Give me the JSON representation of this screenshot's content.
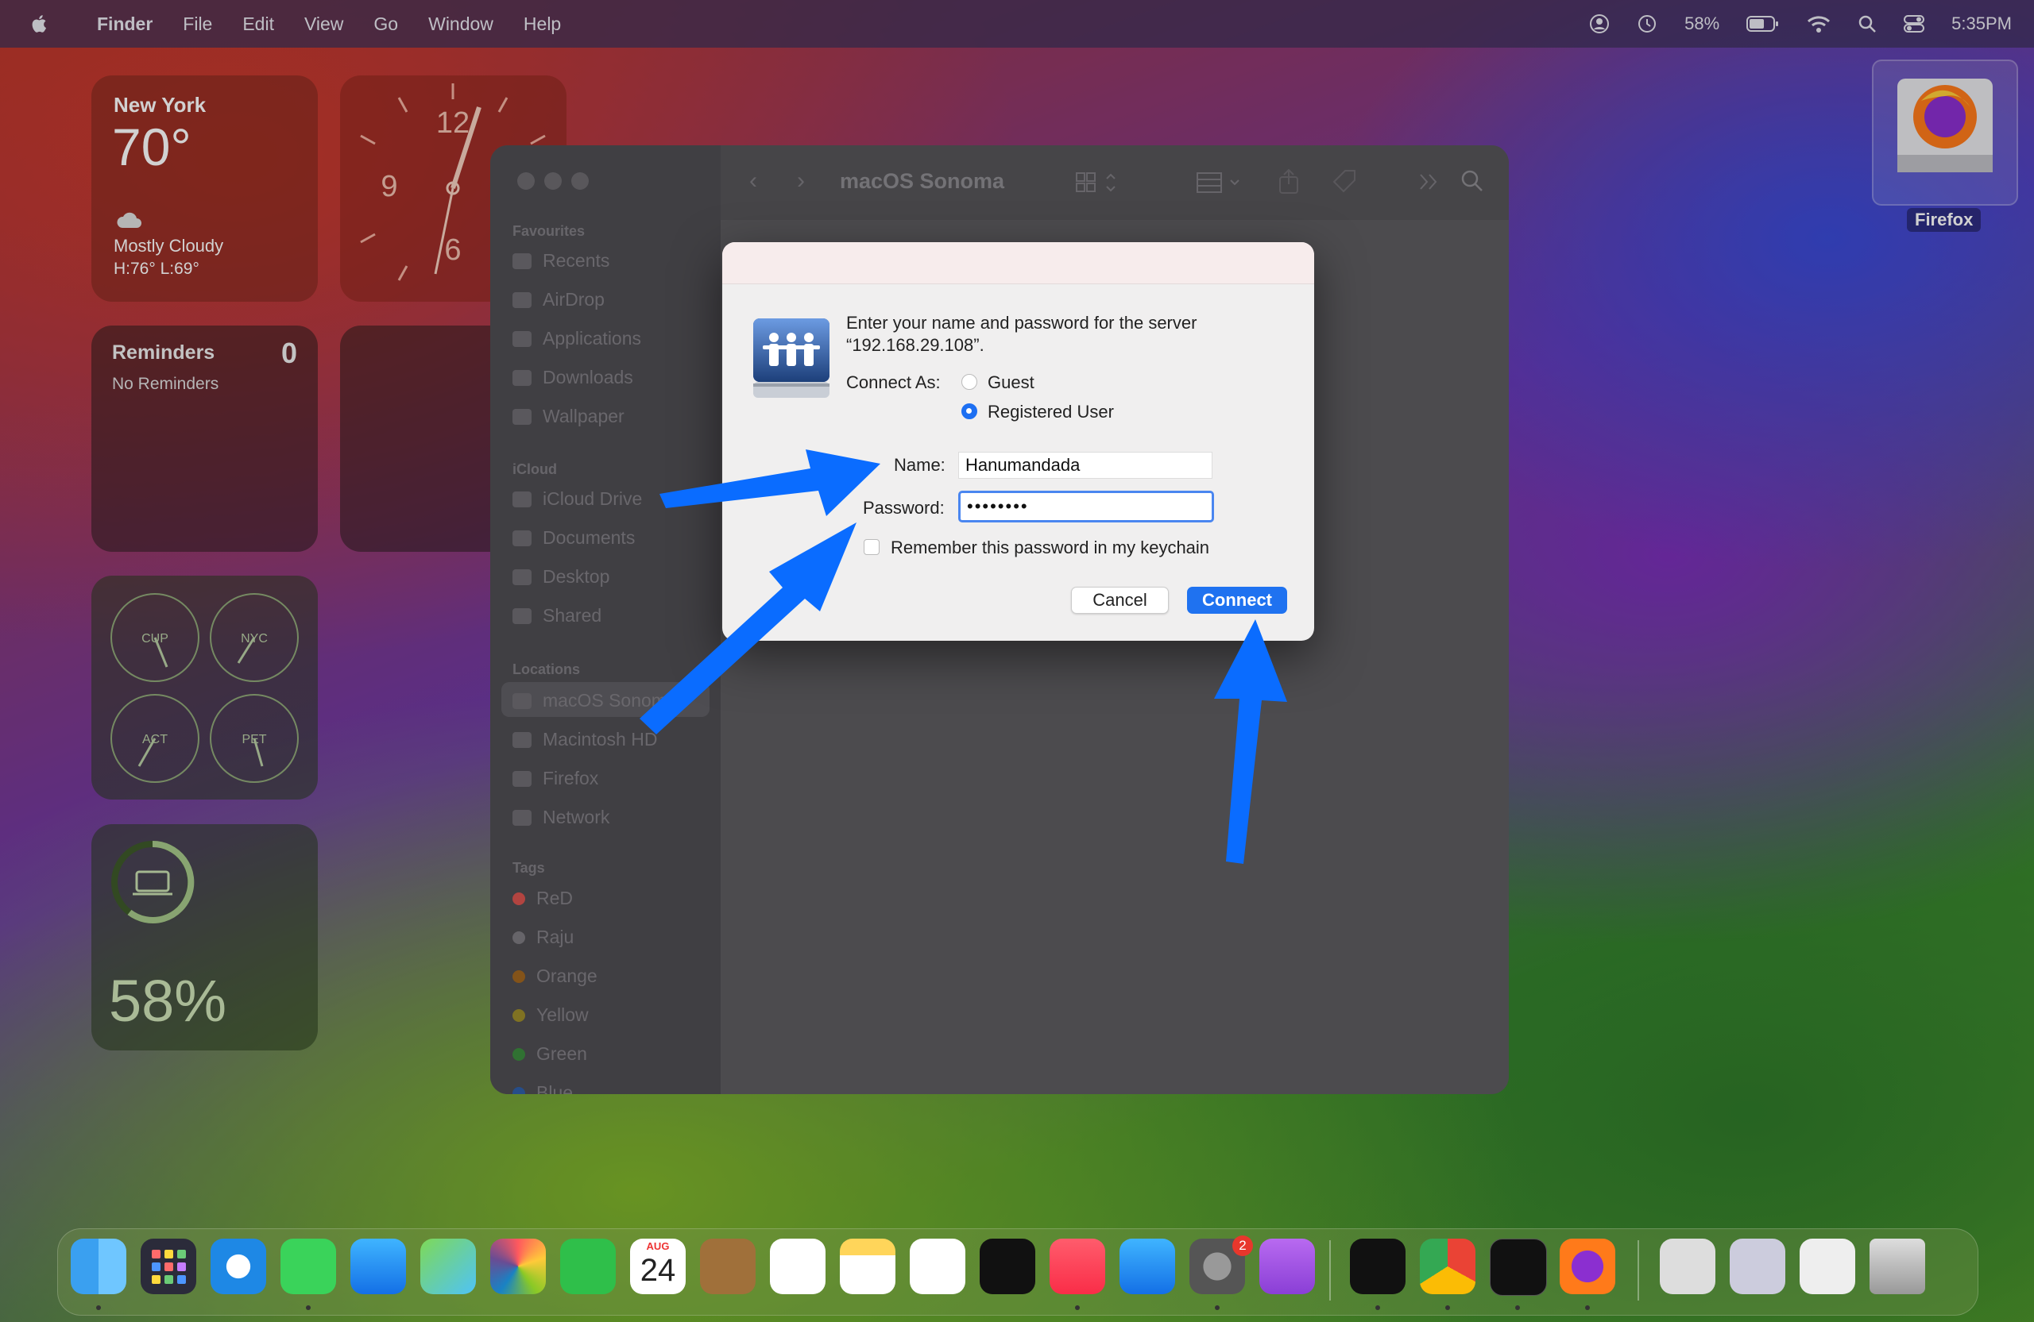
{
  "menubar": {
    "app": "Finder",
    "items": [
      "File",
      "Edit",
      "View",
      "Go",
      "Window",
      "Help"
    ],
    "battery_pct": "58%",
    "time": "5:35PM"
  },
  "widgets": {
    "weather": {
      "city": "New York",
      "temp": "70°",
      "condition": "Mostly Cloudy",
      "high_low": "H:76° L:69°"
    },
    "clock": {
      "numerals": [
        "12",
        "9",
        "6"
      ]
    },
    "reminders": {
      "title": "Reminders",
      "count": "0",
      "subtitle": "No Reminders"
    },
    "world_clocks": [
      "CUP",
      "NYC",
      "ACT",
      "PET"
    ],
    "battery": {
      "percent": "58%"
    }
  },
  "desktop": {
    "firefox_label": "Firefox"
  },
  "finder": {
    "title": "macOS Sonoma",
    "sections": {
      "favourites": "Favourites",
      "icloud": "iCloud",
      "locations": "Locations",
      "tags": "Tags"
    },
    "favourites": [
      "Recents",
      "AirDrop",
      "Applications",
      "Downloads",
      "Wallpaper"
    ],
    "icloud": [
      "iCloud Drive",
      "Documents",
      "Desktop",
      "Shared"
    ],
    "locations": [
      "macOS Sonoma",
      "Macintosh HD",
      "Firefox",
      "Network"
    ],
    "tags": [
      {
        "name": "ReD",
        "color": "#d9534f"
      },
      {
        "name": "Raju",
        "color": "#7d7b80"
      },
      {
        "name": "Orange",
        "color": "#e08a2c"
      },
      {
        "name": "Yellow",
        "color": "#d8c03a"
      },
      {
        "name": "Green",
        "color": "#4caf50"
      },
      {
        "name": "Blue",
        "color": "#3a7be0"
      }
    ]
  },
  "dialog": {
    "prompt_line1": "Enter your name and password for the server",
    "prompt_line2": "“192.168.29.108”.",
    "connect_as_label": "Connect As:",
    "option_guest": "Guest",
    "option_registered": "Registered User",
    "selected_option": "Registered User",
    "name_label": "Name:",
    "name_value": "Hanumandada",
    "password_label": "Password:",
    "password_value": "••••••••",
    "remember_label": "Remember this password in my keychain",
    "remember_checked": false,
    "cancel_label": "Cancel",
    "connect_label": "Connect"
  },
  "dock": {
    "calendar_month": "AUG",
    "calendar_day": "24",
    "settings_badge": "2"
  },
  "colors": {
    "accent": "#1f72f0",
    "arrow": "#0a6cff"
  }
}
